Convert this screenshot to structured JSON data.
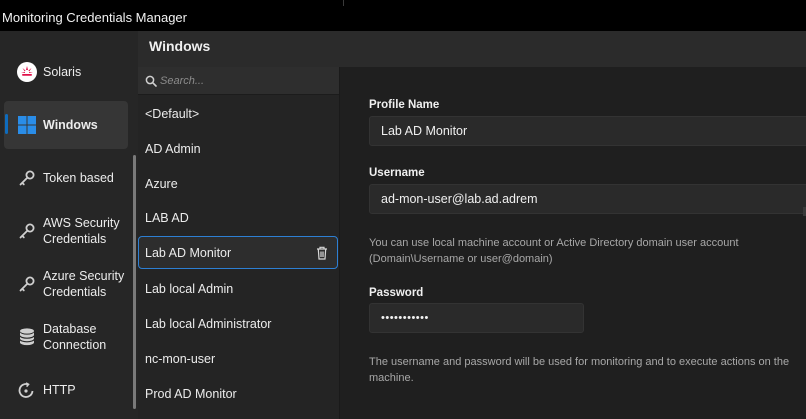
{
  "window": {
    "title": "Monitoring Credentials Manager"
  },
  "sidebar": {
    "items": [
      {
        "label": "Solaris",
        "icon": "solaris-icon"
      },
      {
        "label": "Windows",
        "icon": "windows-icon",
        "active": true
      },
      {
        "label": "Token based",
        "icon": "key-icon"
      },
      {
        "label": "AWS Security Credentials",
        "line1": "AWS Security",
        "line2": "Credentials",
        "icon": "key-icon"
      },
      {
        "label": "Azure Security Credentials",
        "line1": "Azure Security",
        "line2": "Credentials",
        "icon": "key-icon"
      },
      {
        "label": "Database Connection",
        "line1": "Database",
        "line2": "Connection",
        "icon": "database-icon"
      },
      {
        "label": "HTTP",
        "icon": "http-icon"
      }
    ]
  },
  "header": {
    "title": "Windows"
  },
  "search": {
    "placeholder": "Search..."
  },
  "profiles": {
    "items": [
      "<Default>",
      "AD Admin",
      "Azure",
      "LAB AD",
      "Lab AD Monitor",
      "Lab local Admin",
      "Lab local Administrator",
      "nc-mon-user",
      "Prod AD Monitor"
    ],
    "selected": "Lab AD Monitor"
  },
  "form": {
    "profile_name_label": "Profile Name",
    "profile_name_value": "Lab AD Monitor",
    "username_label": "Username",
    "username_value": "ad-mon-user@lab.ad.adrem",
    "username_help_line1": "You can use local machine account or Active Directory domain user account",
    "username_help_line2": "(Domain\\Username or user@domain)",
    "password_label": "Password",
    "password_value": "•••••••••••",
    "password_help_line1": "The username and password will be used for monitoring and to execute actions on the",
    "password_help_line2": "machine."
  },
  "colors": {
    "accent": "#0f6cbd",
    "selection_border": "#2d7fd3",
    "solaris_red": "#e0114a",
    "windows_blue": "#2a8de8"
  }
}
